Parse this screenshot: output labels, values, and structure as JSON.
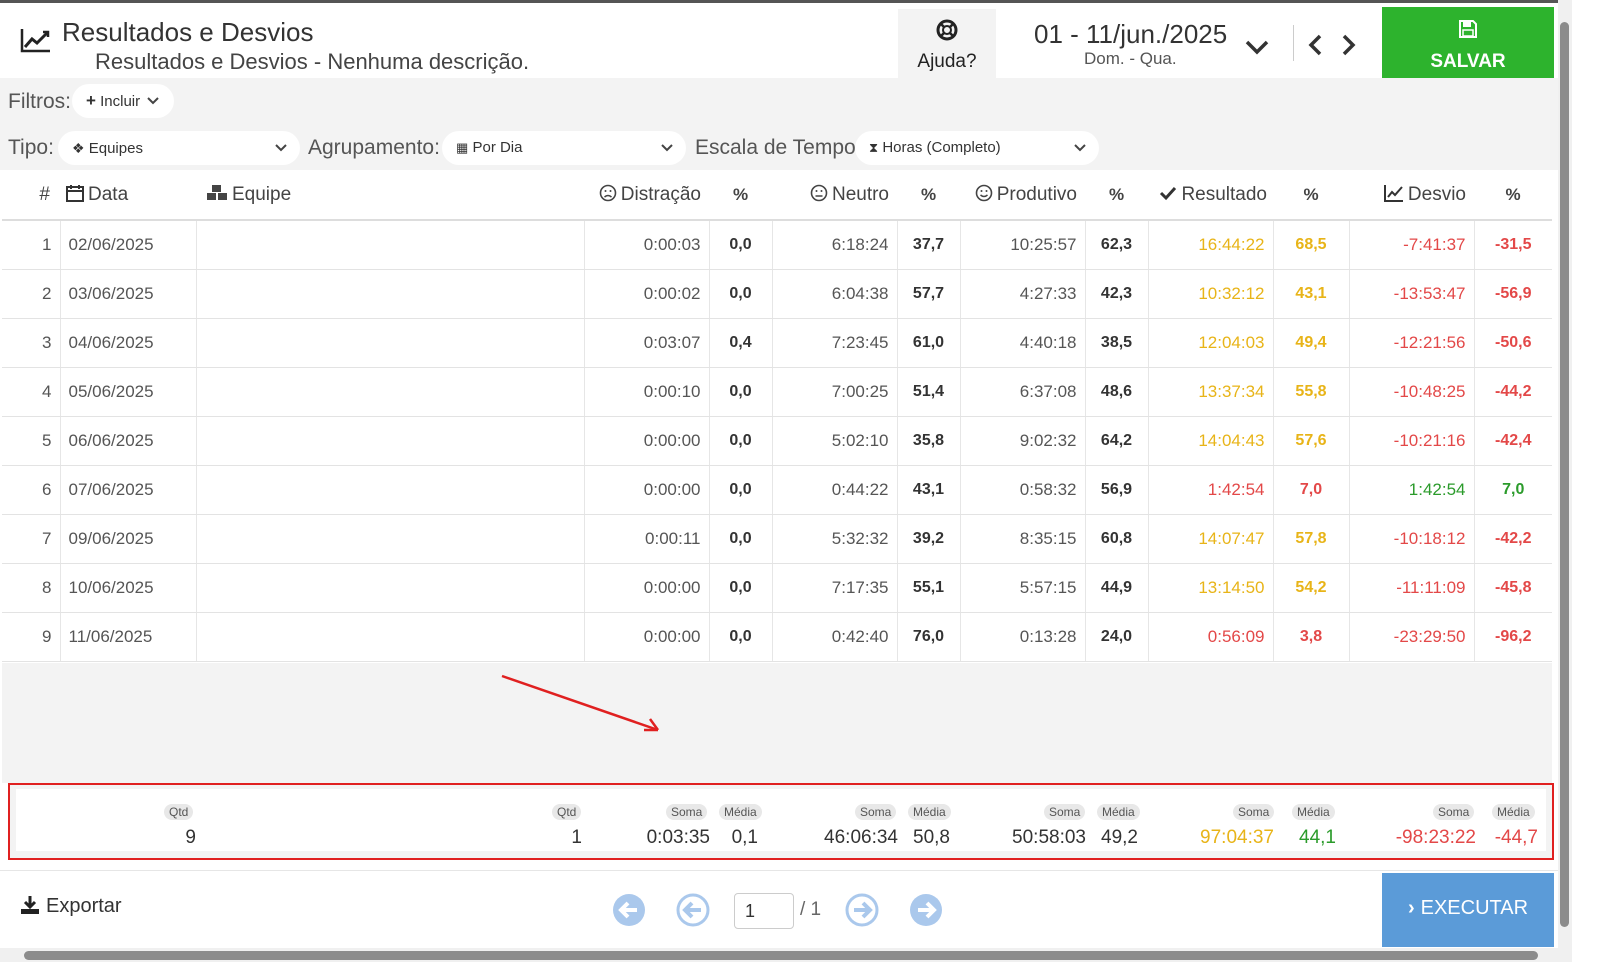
{
  "header": {
    "title": "Resultados e Desvios",
    "subtitle": "Resultados e Desvios - Nenhuma descrição.",
    "help_label": "Ajuda?",
    "date_range": "01 - 11/jun./2025",
    "date_days": "Dom. - Qua.",
    "save_label": "SALVAR",
    "save_color": "#2db32d"
  },
  "filters": {
    "filtros_label": "Filtros:",
    "include_label": "Incluir",
    "tipo_label": "Tipo:",
    "tipo_value": "Equipes",
    "agrup_label": "Agrupamento:",
    "agrup_value": "Por Dia",
    "escala_label": "Escala de Tempo:",
    "escala_value": "Horas (Completo)"
  },
  "table": {
    "headers": [
      "#",
      "Data",
      "Equipe",
      "Distração",
      "%",
      "Neutro",
      "%",
      "Produtivo",
      "%",
      "Resultado",
      "%",
      "Desvio",
      "%"
    ],
    "rows": [
      [
        "1",
        "02/06/2025",
        "",
        "0:00:03",
        "0,0",
        "6:18:24",
        "37,7",
        "10:25:57",
        "62,3",
        "16:44:22",
        "68,5",
        "-7:41:37",
        "-31,5"
      ],
      [
        "2",
        "03/06/2025",
        "",
        "0:00:02",
        "0,0",
        "6:04:38",
        "57,7",
        "4:27:33",
        "42,3",
        "10:32:12",
        "43,1",
        "-13:53:47",
        "-56,9"
      ],
      [
        "3",
        "04/06/2025",
        "",
        "0:03:07",
        "0,4",
        "7:23:45",
        "61,0",
        "4:40:18",
        "38,5",
        "12:04:03",
        "49,4",
        "-12:21:56",
        "-50,6"
      ],
      [
        "4",
        "05/06/2025",
        "",
        "0:00:10",
        "0,0",
        "7:00:25",
        "51,4",
        "6:37:08",
        "48,6",
        "13:37:34",
        "55,8",
        "-10:48:25",
        "-44,2"
      ],
      [
        "5",
        "06/06/2025",
        "",
        "0:00:00",
        "0,0",
        "5:02:10",
        "35,8",
        "9:02:32",
        "64,2",
        "14:04:43",
        "57,6",
        "-10:21:16",
        "-42,4"
      ],
      [
        "6",
        "07/06/2025",
        "",
        "0:00:00",
        "0,0",
        "0:44:22",
        "43,1",
        "0:58:32",
        "56,9",
        "1:42:54",
        "7,0",
        "1:42:54",
        "7,0"
      ],
      [
        "7",
        "09/06/2025",
        "",
        "0:00:11",
        "0,0",
        "5:32:32",
        "39,2",
        "8:35:15",
        "60,8",
        "14:07:47",
        "57,8",
        "-10:18:12",
        "-42,2"
      ],
      [
        "8",
        "10/06/2025",
        "",
        "0:00:00",
        "0,0",
        "7:17:35",
        "55,1",
        "5:57:15",
        "44,9",
        "13:14:50",
        "54,2",
        "-11:11:09",
        "-45,8"
      ],
      [
        "9",
        "11/06/2025",
        "",
        "0:00:00",
        "0,0",
        "0:42:40",
        "76,0",
        "0:13:28",
        "24,0",
        "0:56:09",
        "3,8",
        "-23:29:50",
        "-96,2"
      ]
    ],
    "row_colors": {
      "resultado": [
        "yellow",
        "yellow",
        "yellow",
        "yellow",
        "yellow",
        "red",
        "yellow",
        "yellow",
        "red"
      ],
      "desvio": [
        "red",
        "red",
        "red",
        "red",
        "red",
        "green",
        "red",
        "red",
        "red"
      ]
    }
  },
  "summary": {
    "qtd_label": "Qtd",
    "soma_label": "Soma",
    "media_label": "Média",
    "data_qtd": "9",
    "equipe_qtd": "1",
    "distracao_soma": "0:03:35",
    "distracao_media": "0,1",
    "neutro_soma": "46:06:34",
    "neutro_media": "50,8",
    "produtivo_soma": "50:58:03",
    "produtivo_media": "49,2",
    "resultado_soma": "97:04:37",
    "resultado_media": "44,1",
    "desvio_soma": "-98:23:22",
    "desvio_media": "-44,7"
  },
  "footer": {
    "export_label": "Exportar",
    "page_value": "1",
    "page_total": "/ 1",
    "execute_label": "EXECUTAR"
  },
  "colors": {
    "yellow": "#e8b418",
    "red": "#e34848",
    "green": "#2b9b2b",
    "execute": "#5b9bd8",
    "annotation": "#e02020"
  }
}
